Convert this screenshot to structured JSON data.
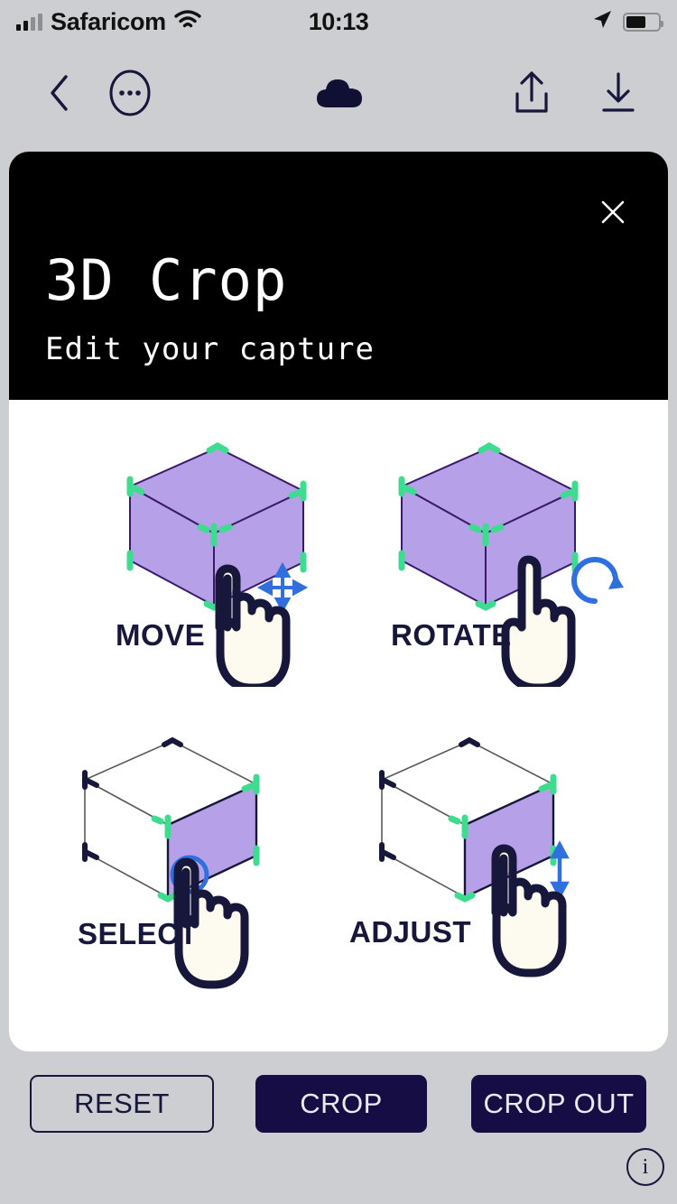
{
  "colors": {
    "page_bg": "#cdced1",
    "card_bg": "#ffffff",
    "header_bg": "#000000",
    "accent_navy": "#150d44",
    "label_navy": "#16173a",
    "cube_purple": "#b6a1e8",
    "cube_edge": "#3a1a6b",
    "handle_green": "#3ddc8f",
    "gesture_blue": "#2f6fe0",
    "hand_fill": "#fdfaef",
    "hand_outline": "#16173a"
  },
  "statusbar": {
    "carrier": "Safaricom",
    "time": "10:13",
    "signal_icon": "signal-bars-icon",
    "wifi_icon": "wifi-icon",
    "location_icon": "location-arrow-icon",
    "battery_icon": "battery-icon",
    "battery_level": "62%"
  },
  "toolbar": {
    "back_icon": "chevron-left-icon",
    "more_icon": "ellipsis-circle-icon",
    "cloud_icon": "cloud-icon",
    "share_icon": "share-upload-icon",
    "download_icon": "download-icon"
  },
  "card": {
    "title": "3D Crop",
    "subtitle": "Edit your capture",
    "close_icon": "close-x-icon"
  },
  "gestures": [
    {
      "label": "MOVE",
      "cube_style": "filled",
      "gesture_icon": "move-arrows-icon",
      "hand_icon": "pointing-hand-icon"
    },
    {
      "label": "ROTATE",
      "cube_style": "filled",
      "gesture_icon": "rotate-arrow-icon",
      "hand_icon": "two-finger-hand-icon"
    },
    {
      "label": "SELECT",
      "cube_style": "wireframe-right-face",
      "gesture_icon": "tap-circle-icon",
      "hand_icon": "pointing-hand-icon"
    },
    {
      "label": "ADJUST",
      "cube_style": "wireframe-front-face",
      "gesture_icon": "vertical-arrows-icon",
      "hand_icon": "pointing-hand-icon"
    }
  ],
  "actions": {
    "reset": "RESET",
    "crop": "CROP",
    "crop_out": "CROP OUT"
  },
  "info": {
    "label": "i",
    "icon": "info-circle-icon"
  }
}
